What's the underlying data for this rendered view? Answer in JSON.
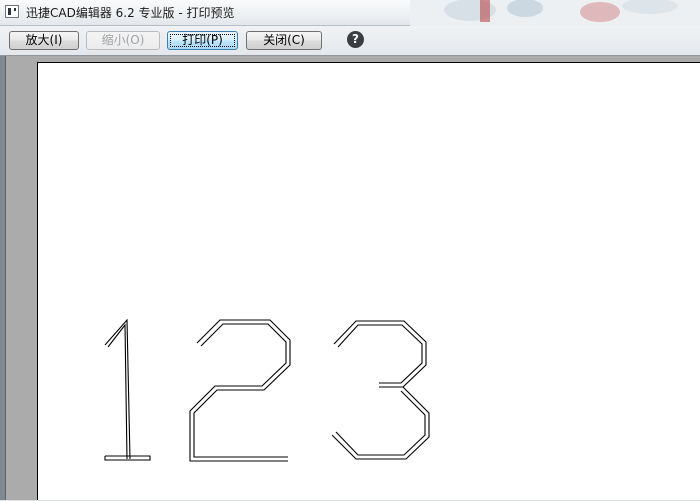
{
  "window": {
    "title": "迅捷CAD编辑器 6.2 专业版  - 打印预览"
  },
  "toolbar": {
    "zoom_in_label": "放大(I)",
    "zoom_out_label": "缩小(O)",
    "print_label": "打印(P)",
    "close_label": "关闭(C)",
    "help_glyph": "?"
  },
  "preview": {
    "drawing_text": "123"
  },
  "colors": {
    "paper": "#ffffff",
    "preview_background": "#ababab",
    "line": "#000000"
  }
}
